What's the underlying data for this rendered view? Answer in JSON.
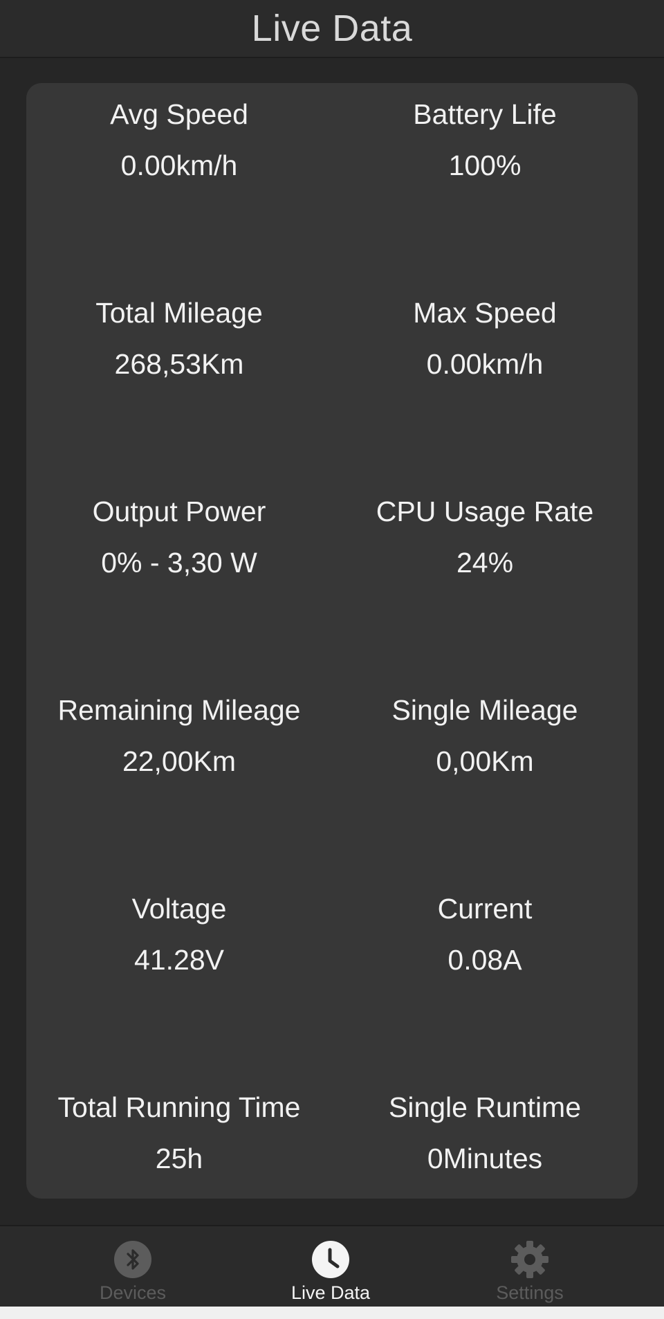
{
  "header": {
    "title": "Live Data"
  },
  "stats": [
    {
      "label": "Avg Speed",
      "value": "0.00km/h"
    },
    {
      "label": "Battery Life",
      "value": "100%"
    },
    {
      "label": "Total Mileage",
      "value": "268,53Km"
    },
    {
      "label": "Max Speed",
      "value": "0.00km/h"
    },
    {
      "label": "Output Power",
      "value": "0% - 3,30 W"
    },
    {
      "label": "CPU Usage Rate",
      "value": "24%"
    },
    {
      "label": "Remaining Mileage",
      "value": "22,00Km"
    },
    {
      "label": "Single Mileage",
      "value": "0,00Km"
    },
    {
      "label": "Voltage",
      "value": "41.28V"
    },
    {
      "label": "Current",
      "value": "0.08A"
    },
    {
      "label": "Total Running Time",
      "value": "25h"
    },
    {
      "label": "Single Runtime",
      "value": "0Minutes"
    }
  ],
  "nav": {
    "items": [
      {
        "label": "Devices",
        "icon": "bluetooth-icon",
        "active": false
      },
      {
        "label": "Live Data",
        "icon": "clock-icon",
        "active": true
      },
      {
        "label": "Settings",
        "icon": "gear-icon",
        "active": false
      }
    ]
  },
  "colors": {
    "background": "#262626",
    "card": "#373737",
    "text": "#f2f2f2",
    "nav_inactive": "#5c5c5c",
    "nav_active": "#f4f4f4"
  }
}
